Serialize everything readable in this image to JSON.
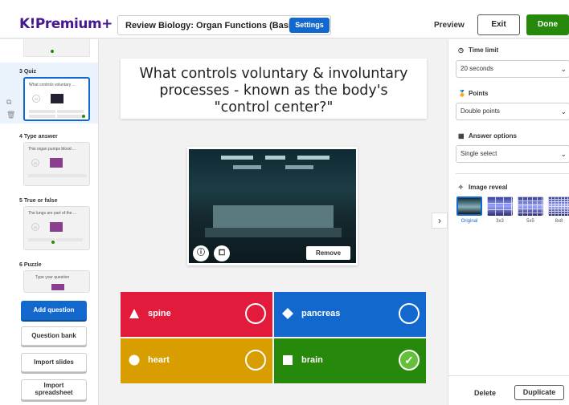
{
  "header": {
    "logo": "K!Premium+",
    "quiz_title": "Review Biology: Organ Functions (Basic)",
    "settings_label": "Settings",
    "preview_label": "Preview",
    "exit_label": "Exit",
    "done_label": "Done"
  },
  "sidebar": {
    "slides": [
      {
        "number_type": "3 Quiz",
        "preview": "What controls voluntary ..."
      },
      {
        "number_type": "4 Type answer",
        "preview": "This organ pumps blood ..."
      },
      {
        "number_type": "5 True or false",
        "preview": "The lungs are part of the ..."
      },
      {
        "number_type": "6 Puzzle",
        "preview": "Type your question"
      }
    ],
    "add_question_label": "Add question",
    "question_bank_label": "Question bank",
    "import_slides_label": "Import slides",
    "import_spreadsheet_label_1": "Import",
    "import_spreadsheet_label_2": "spreadsheet"
  },
  "main": {
    "question": "What controls voluntary & involuntary processes - known as the body's \"control center?\"",
    "remove_label": "Remove",
    "answers": [
      {
        "text": "spine",
        "correct": false,
        "color": "#e21b3c",
        "shape": "triangle"
      },
      {
        "text": "pancreas",
        "correct": false,
        "color": "#1368ce",
        "shape": "diamond"
      },
      {
        "text": "heart",
        "correct": false,
        "color": "#d89e00",
        "shape": "circle"
      },
      {
        "text": "brain",
        "correct": true,
        "color": "#26890c",
        "shape": "square"
      }
    ]
  },
  "settings_panel": {
    "time_limit_label": "Time limit",
    "time_limit_value": "20 seconds",
    "points_label": "Points",
    "points_value": "Double points",
    "answer_options_label": "Answer options",
    "answer_options_value": "Single select",
    "image_reveal_label": "Image reveal",
    "reveal_options": [
      "Original",
      "3x3",
      "5x5",
      "8x8"
    ],
    "delete_label": "Delete",
    "duplicate_label": "Duplicate"
  }
}
